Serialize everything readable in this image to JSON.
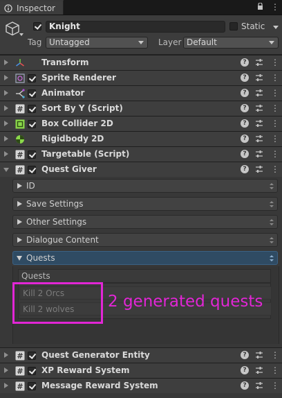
{
  "tab": {
    "title": "Inspector",
    "icon": "info-icon",
    "menu": "⋮"
  },
  "object": {
    "name": "Knight",
    "active": true,
    "static_label": "Static",
    "static_checked": false,
    "tag_label": "Tag",
    "tag_value": "Untagged",
    "layer_label": "Layer",
    "layer_value": "Default"
  },
  "components": [
    {
      "label": "Transform",
      "icon": "transform-icon",
      "has_checkbox": false
    },
    {
      "label": "Sprite Renderer",
      "icon": "sprite-renderer-icon",
      "has_checkbox": true
    },
    {
      "label": "Animator",
      "icon": "animator-icon",
      "has_checkbox": true
    },
    {
      "label": "Sort By Y (Script)",
      "icon": "script-icon",
      "has_checkbox": true
    },
    {
      "label": "Box Collider 2D",
      "icon": "box-collider-icon",
      "has_checkbox": true
    },
    {
      "label": "Rigidbody 2D",
      "icon": "rigidbody-icon",
      "has_checkbox": false
    },
    {
      "label": "Targetable (Script)",
      "icon": "script-icon",
      "has_checkbox": true
    },
    {
      "label": "Quest Giver",
      "icon": "script-icon",
      "has_checkbox": true,
      "expanded": true
    }
  ],
  "quest_giver": {
    "foldouts": [
      "ID",
      "Save Settings",
      "Other Settings",
      "Dialogue Content"
    ],
    "quests_foldout": "Quests",
    "list_header": "Quests",
    "quests": [
      "Kill 2 Orcs",
      "Kill 2 wolves"
    ]
  },
  "annotation": {
    "text": "2 generated quests",
    "color": "#e226d6"
  },
  "bottom_components": [
    {
      "label": "Quest Generator Entity",
      "icon": "script-icon"
    },
    {
      "label": "XP Reward System",
      "icon": "script-icon"
    },
    {
      "label": "Message Reward System",
      "icon": "script-icon"
    }
  ],
  "controls": {
    "help": "?",
    "kebab": "⋮"
  }
}
